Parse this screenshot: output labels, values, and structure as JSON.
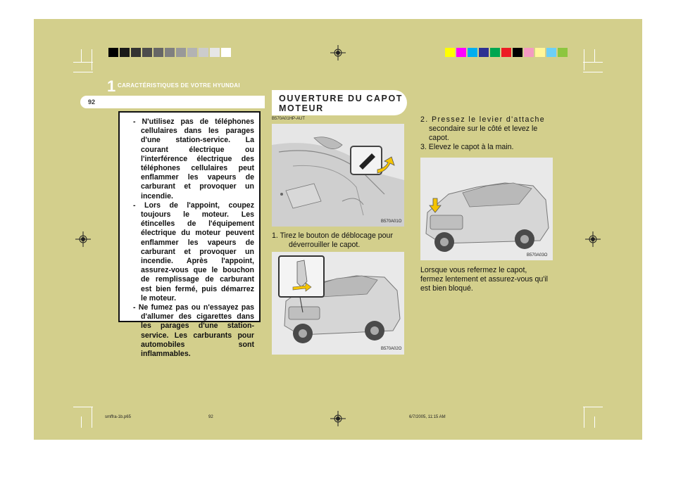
{
  "header": {
    "chapter_number": "1",
    "chapter_title": "CARACTÉRISTIQUES DE VOTRE HYUNDAI",
    "page_number": "92"
  },
  "warning": {
    "items": [
      "- N'utilisez pas de téléphones cellulaires dans les parages d'une station-service. La courant électrique ou l'interférence électrique des téléphones cellulaires peut enflammer les vapeurs de carburant et provoquer un incendie.",
      "- Lors de l'appoint, coupez toujours le moteur. Les étincelles de l'équipement électrique du moteur peuvent enflammer les vapeurs de carburant et provoquer un incendie. Après l'appoint, assurez-vous que le bouchon de remplissage de carburant est bien fermé, puis démarrez le moteur.",
      "- Ne fumez pas ou n'essayez pas d'allumer des cigarettes dans les parages d'une station-service. Les carburants pour automobiles sont inflammables."
    ]
  },
  "section": {
    "title_line1": "OUVERTURE DU CAPOT",
    "title_line2": "MOTEUR",
    "ref_code": "B570A01HP-AUT"
  },
  "figures": {
    "fig1": "B570A01O",
    "fig2": "B570A02O",
    "fig3": "B570A03O"
  },
  "steps": {
    "step1_line1": "1. Tirez le bouton de déblocage pour",
    "step1_line2": "déverrouiller le capot.",
    "step2_line1": "2. Pressez le levier d'attache",
    "step2_line2": "secondaire sur le côté et levez le",
    "step2_line3": "capot.",
    "step3": "3. Elevez le capot à la main.",
    "closing_line1": "Lorsque vous  refermez le capot,",
    "closing_line2": "fermez lentement et assurez-vous qu'il",
    "closing_line3": "est bien bloqué."
  },
  "footer": {
    "file_name": "smffra-1b.p65",
    "page": "92",
    "timestamp": "6/7/2005, 11:15 AM"
  },
  "colors": {
    "page_background": "#d3cf8c",
    "grayscale_bar": [
      "#000000",
      "#1a1a1a",
      "#333333",
      "#4d4d4d",
      "#666666",
      "#808080",
      "#999999",
      "#b3b3b3",
      "#cccccc",
      "#e6e6e6",
      "#ffffff"
    ],
    "color_bar": [
      "#ffff00",
      "#ff00ff",
      "#00aeef",
      "#2e3192",
      "#00a651",
      "#ed1c24",
      "#000000",
      "#f49ac1",
      "#fff799",
      "#6dcff6",
      "#8dc63f"
    ]
  }
}
